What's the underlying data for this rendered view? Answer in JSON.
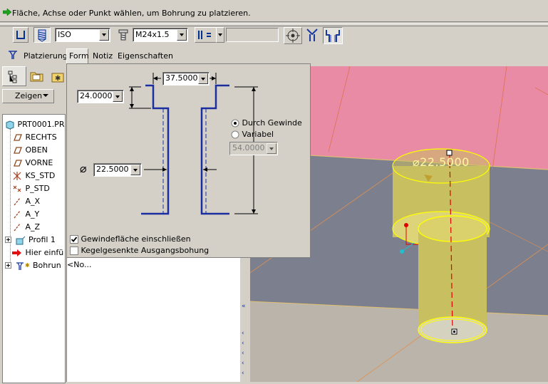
{
  "status_message": "Fläche, Achse oder Punkt wählen, um Bohrung zu platzieren.",
  "toolbar": {
    "standard_value": "ISO",
    "size_value": "M24x1.5",
    "depth_value": ""
  },
  "tabs": [
    {
      "label": "Platzierung"
    },
    {
      "label": "Form"
    },
    {
      "label": "Notiz"
    },
    {
      "label": "Eigenschaften"
    }
  ],
  "sidebar": {
    "show_button": "Zeigen"
  },
  "tree": {
    "items": [
      {
        "label": "PRT0001.PR"
      },
      {
        "label": "RECHTS"
      },
      {
        "label": "OBEN"
      },
      {
        "label": "VORNE"
      },
      {
        "label": "KS_STD"
      },
      {
        "label": "P_STD"
      },
      {
        "label": "A_X"
      },
      {
        "label": "A_Y"
      },
      {
        "label": "A_Z"
      },
      {
        "label": "Profil 1"
      },
      {
        "label": "Hier einfü"
      },
      {
        "label": "Bohrun"
      }
    ],
    "note_row": "<No..."
  },
  "shape_panel": {
    "width_value": "37.5000",
    "depth_value": "24.0000",
    "diameter_value": "22.5000",
    "diameter_symbol": "⌀",
    "option_through_thread": "Durch Gewinde",
    "option_variable": "Variabel",
    "variable_value": "54.0000",
    "check_include_thread_surface": "Gewindefläche einschließen",
    "check_countersunk_exit": "Kegelgesenkte Ausgangsbohung"
  },
  "viewport": {
    "diameter_label": "⌀22.5000"
  },
  "colors": {
    "model_top": "#e98ba5",
    "model_side": "#7c7f8e",
    "hole": "#c8c060",
    "highlight": "#ffff00",
    "profile_line": "#1a2ea0"
  }
}
